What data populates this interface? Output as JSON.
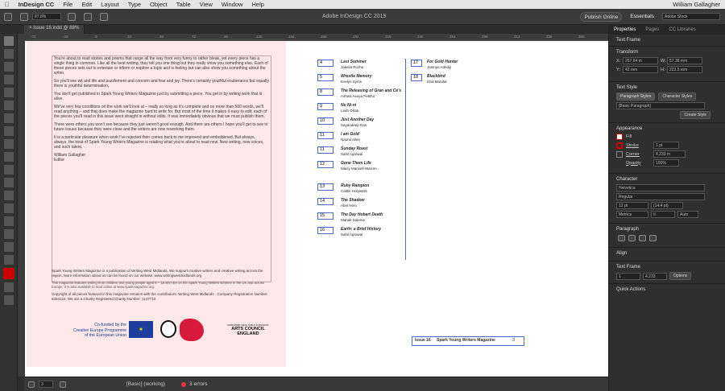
{
  "macbar": {
    "app": "InDesign CC",
    "menus": [
      "File",
      "Edit",
      "Layout",
      "Type",
      "Object",
      "Table",
      "View",
      "Window",
      "Help"
    ],
    "user": "William Gallagher"
  },
  "control": {
    "zoom": "87.8%",
    "title": "Adobe InDesign CC 2019",
    "publish": "Publish Online",
    "workspace": "Essentials",
    "search": "Adobe Stock"
  },
  "document": {
    "tab": "Issue 16.indd @ 88%"
  },
  "ruler": {
    "ticks": [
      "-72",
      "-24",
      "0",
      "24",
      "48",
      "72",
      "96",
      "120",
      "144",
      "168",
      "192",
      "216",
      "240",
      "264",
      "288",
      "312",
      "336",
      "360"
    ]
  },
  "left_page": {
    "paragraphs": [
      "You're about to read stories and poems that range all the way from very funny to rather bleak, yet every piece has a single thing in common. Like all the best writing, they tell you one thing but they really show you something else. Each of these pieces sets out to entertain or inform or explore a topic and is feeling but can also show you something about the writer.",
      "So you'll see wit and life and puzzlement and concern and fear and joy. There's certainly youthful exuberance but equally there is youthful determination.",
      "You don't get published in Spark Young Writers Magazine just by submitting a piece. You get in by writing work that is alive.",
      "We've very few conditions on the work we'll look at – really so long as it's complete and no more than 500 words, we'll read anything – and that does make the magazine hard to write for. But most of the time it makes it easy to edit; each of the pieces you'll read in this issue went straight in without edits. It was immediately obvious that we must publish them.",
      "There were others you won't see because they just weren't good enough. And there are others I hope you'll get to see in future issues because they were close and the writers are now reworking them.",
      "It is a particular pleasure when work I've rejected then comes back to me improved and emboldened. But always, always, the treat of Spark Young Writers Magazine is reading what you're about to read now. New writing, new voices, and such talent."
    ],
    "signoff": [
      "William Gallagher",
      "Editor"
    ],
    "footer": [
      "Spark Young Writers Magazine is a publication of Writing West Midlands. We support creative writers and creative writing across the region. More information about us can be found on our website: www.writingwestmidlands.org",
      "This magazine features writing from children and young people aged 8 – 18 who are on the Spark Young Writers scheme in the UK and across Europe. It is also available to read online at www.sparkmagazine.org.",
      "Copyright of all pieces featured in this magazine remains with the contributors. Writing West Midlands - Company Registration Number: 6264124. We are a Charity Registered Charity Number: 1147710."
    ],
    "eu": [
      "Co-funded by the",
      "Creative Europe Programme",
      "of the European Union"
    ],
    "arts": [
      "SUPPORTED USING PUBLIC FUNDING BY",
      "ARTS COUNCIL",
      "ENGLAND"
    ]
  },
  "toc": [
    {
      "n": "4",
      "t": "Last Summer",
      "a": "Jakelia Rozha"
    },
    {
      "n": "5",
      "t": "Wrestle Memory",
      "a": "Evelyn Syms"
    },
    {
      "n": "8",
      "t": "The Releasing of Gran and Ce's",
      "a": "Ashwa Asuya Pettifor"
    },
    {
      "n": "9",
      "t": "No Ni-ni",
      "a": "Leah Orlati"
    },
    {
      "n": "10",
      "t": "Just Another Day",
      "a": "Sayandeep Das"
    },
    {
      "n": "11",
      "t": "I am Gold",
      "a": "Naomi Allen"
    },
    {
      "n": "11",
      "t": "Sunday Roast",
      "a": "Sahil Agrawal"
    },
    {
      "n": "12",
      "t": "Gone Them Life",
      "a": "Maisy Mansell-Warren"
    },
    {
      "n": "13",
      "t": "Ruby Rampion",
      "a": "Caitlin Holywells"
    },
    {
      "n": "14",
      "t": "The Shadow",
      "a": "Abel Hero"
    },
    {
      "n": "15",
      "t": "The Day Hobart Death",
      "a": "Mahak Saleme"
    },
    {
      "n": "16",
      "t": "Earth: a Brief History",
      "a": "Sahil Agrawal"
    }
  ],
  "toc2": [
    {
      "n": "17",
      "t": "For Gold Hunter",
      "a": "Jasmyn Adediji"
    },
    {
      "n": "18",
      "t": "Blackbird",
      "a": "Isha Mandal"
    }
  ],
  "right_footer": {
    "issue": "Issue 16",
    "mag": "Spark Young Writers Magazine",
    "page": "3"
  },
  "status": {
    "page": "3",
    "profile": "[Basic] (working)",
    "errors": "3 errors"
  },
  "panel": {
    "tabs": [
      "Properties",
      "Pages",
      "CC Libraries"
    ],
    "section1": "Text Frame",
    "transform": "Transform",
    "x": "257.64 m",
    "y": "42 mm",
    "w": "57.38 mm",
    "h": "223.5 mm",
    "textstyle": "Text Style",
    "ps_tab": "Paragraph Styles",
    "cs_tab": "Character Styles",
    "pstyle": "[Basic Paragraph]",
    "create": "Create Style",
    "appearance": "Appearance",
    "fill": "Fill",
    "stroke": "Stroke",
    "stroke_w": "1 pt",
    "ctr": "Corner",
    "ctr_val": "4.233 m",
    "opacity": "Opacity",
    "op_val": "100%",
    "character": "Character",
    "font": "Helvetica",
    "fstyle": "Regular",
    "fsize": "12 pt",
    "lead": "(14.4 pt)",
    "tracking": "0",
    "kern": "Metrics",
    "optical": "Auto",
    "paragraph": "Paragraph",
    "align": "Align",
    "textframe": "Text Frame",
    "cols": "1",
    "gutter": "4.233",
    "options": "Options",
    "quick": "Quick Actions"
  },
  "colors": {
    "accent": "#4a6cc7",
    "pink": "#fce8e8",
    "dark": "#2f2f2f"
  }
}
